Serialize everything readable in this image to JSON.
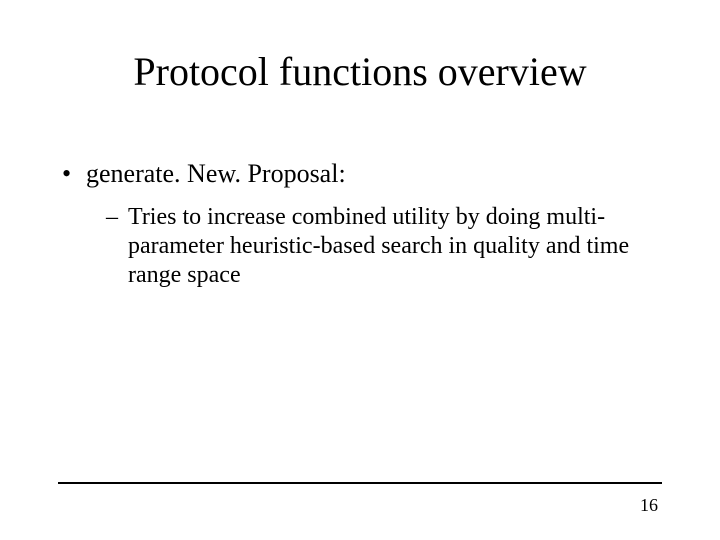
{
  "slide": {
    "title": "Protocol functions overview",
    "bullets": [
      {
        "text": "generate. New. Proposal:",
        "children": [
          {
            "text": "Tries to increase combined utility by doing multi-parameter heuristic-based search in quality and time range space"
          }
        ]
      }
    ],
    "page_number": "16"
  }
}
